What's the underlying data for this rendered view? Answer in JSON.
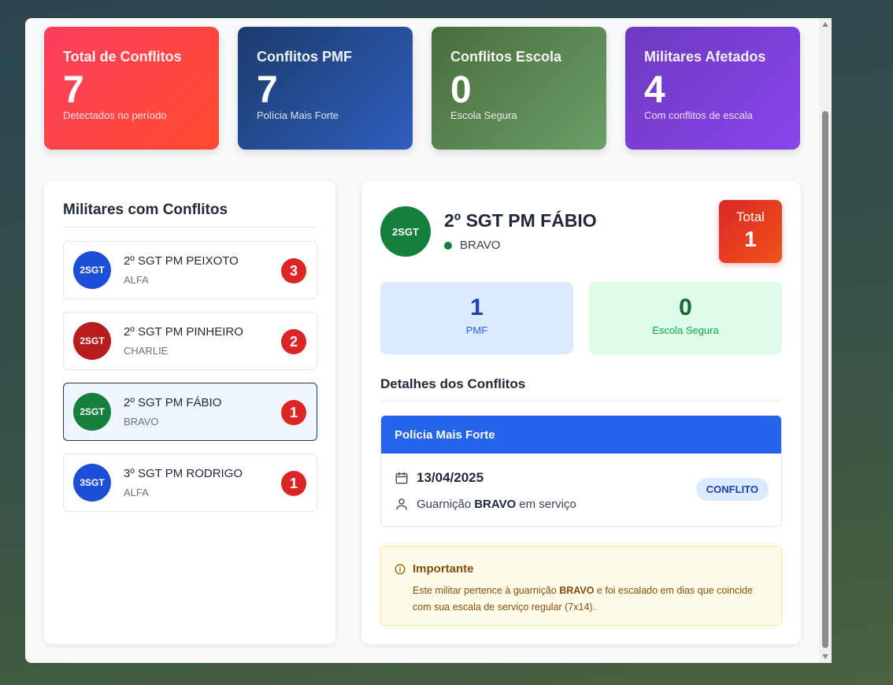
{
  "stats": [
    {
      "title": "Total de Conflitos",
      "value": "7",
      "sub": "Detectados no período"
    },
    {
      "title": "Conflitos PMF",
      "value": "7",
      "sub": "Polícia Mais Forte"
    },
    {
      "title": "Conflitos Escola",
      "value": "0",
      "sub": "Escola Segura"
    },
    {
      "title": "Militares Afetados",
      "value": "4",
      "sub": "Com conflitos de escala"
    }
  ],
  "list": {
    "title": "Militares com Conflitos",
    "items": [
      {
        "avatar": "2SGT",
        "name": "2º SGT PM PEIXOTO",
        "team": "ALFA",
        "count": "3",
        "color": "#1d4ed8"
      },
      {
        "avatar": "2SGT",
        "name": "2º SGT PM PINHEIRO",
        "team": "CHARLIE",
        "count": "2",
        "color": "#b91c1c"
      },
      {
        "avatar": "2SGT",
        "name": "2º SGT PM FÁBIO",
        "team": "BRAVO",
        "count": "1",
        "color": "#15803d"
      },
      {
        "avatar": "3SGT",
        "name": "3º SGT PM RODRIGO",
        "team": "ALFA",
        "count": "1",
        "color": "#1d4ed8"
      }
    ]
  },
  "detail": {
    "avatar": "2SGT",
    "name": "2º SGT PM FÁBIO",
    "team": "BRAVO",
    "total_label": "Total",
    "total_value": "1",
    "pmf_value": "1",
    "pmf_label": "PMF",
    "escola_value": "0",
    "escola_label": "Escola Segura",
    "section_title": "Detalhes dos Conflitos",
    "conflict": {
      "header": "Polícia Mais Forte",
      "date": "13/04/2025",
      "desc_prefix": "Guarnição",
      "desc_team": "BRAVO",
      "desc_suffix": "em serviço",
      "badge": "CONFLITO"
    },
    "notice": {
      "title": "Importante",
      "text_1": "Este militar pertence à guarnição",
      "text_team": "BRAVO",
      "text_2": "e foi escalado em dias que coincide com sua escala de serviço regular (7x14)."
    }
  }
}
